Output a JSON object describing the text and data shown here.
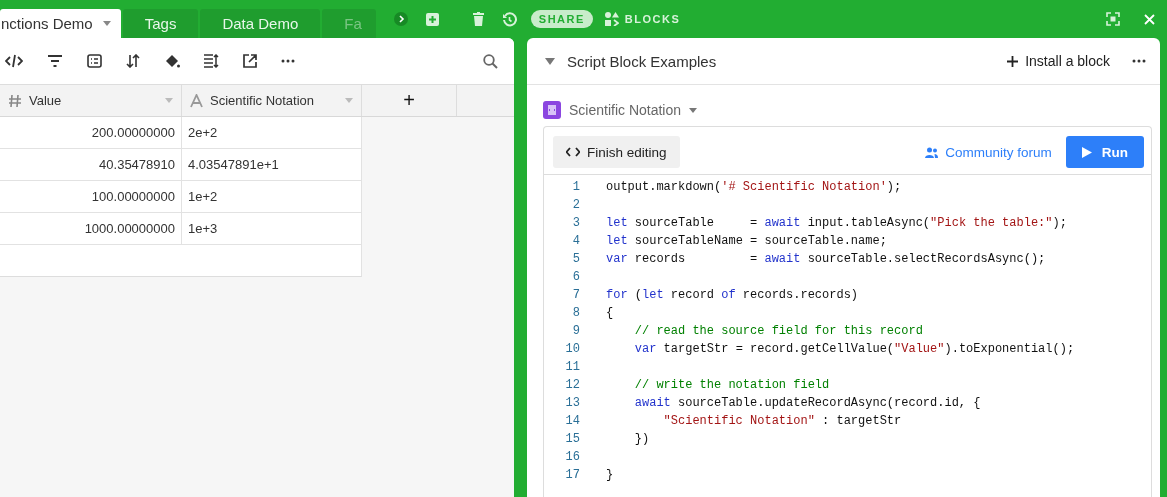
{
  "tabs": [
    {
      "label": "nctions Demo",
      "selected": true
    },
    {
      "label": "Tags",
      "selected": false
    },
    {
      "label": "Data Demo",
      "selected": false
    },
    {
      "label": "Fa",
      "selected": false
    }
  ],
  "top_bar": {
    "share": "SHARE",
    "blocks": "BLOCKS"
  },
  "table": {
    "columns": [
      {
        "label": "Value",
        "kind": "number"
      },
      {
        "label": "Scientific Notation",
        "kind": "text"
      }
    ],
    "add_column": "+",
    "rows": [
      {
        "value": "200.00000000",
        "notation": "2e+2"
      },
      {
        "value": "40.35478910",
        "notation": "4.03547891e+1"
      },
      {
        "value": "100.00000000",
        "notation": "1e+2"
      },
      {
        "value": "1000.00000000",
        "notation": "1e+3"
      }
    ]
  },
  "blocks_panel": {
    "title": "Script Block Examples",
    "install": "Install a block",
    "block_name": "Scientific Notation",
    "finish_editing": "Finish editing",
    "community": "Community forum",
    "run": "Run",
    "code": [
      {
        "number": "1",
        "tokens": [
          {
            "kind": "plain",
            "text": "output.markdown("
          },
          {
            "kind": "string",
            "text": "'# Scientific Notation'"
          },
          {
            "kind": "plain",
            "text": ");"
          }
        ]
      },
      {
        "number": "2"
      },
      {
        "number": "3",
        "tokens": [
          {
            "kind": "keyword",
            "text": "let"
          },
          {
            "kind": "plain",
            "text": " sourceTable     = "
          },
          {
            "kind": "keyword",
            "text": "await"
          },
          {
            "kind": "plain",
            "text": " input.tableAsync("
          },
          {
            "kind": "string",
            "text": "\"Pick the table:\""
          },
          {
            "kind": "plain",
            "text": ");"
          }
        ]
      },
      {
        "number": "4",
        "tokens": [
          {
            "kind": "keyword",
            "text": "let"
          },
          {
            "kind": "plain",
            "text": " sourceTableName = sourceTable.name;"
          }
        ]
      },
      {
        "number": "5",
        "tokens": [
          {
            "kind": "keyword",
            "text": "var"
          },
          {
            "kind": "plain",
            "text": " records         = "
          },
          {
            "kind": "keyword",
            "text": "await"
          },
          {
            "kind": "plain",
            "text": " sourceTable.selectRecordsAsync();"
          }
        ]
      },
      {
        "number": "6"
      },
      {
        "number": "7",
        "tokens": [
          {
            "kind": "keyword",
            "text": "for"
          },
          {
            "kind": "plain",
            "text": " ("
          },
          {
            "kind": "keyword",
            "text": "let"
          },
          {
            "kind": "plain",
            "text": " record "
          },
          {
            "kind": "keyword",
            "text": "of"
          },
          {
            "kind": "plain",
            "text": " records.records)"
          }
        ]
      },
      {
        "number": "8",
        "tokens": [
          {
            "kind": "plain",
            "text": "{"
          }
        ]
      },
      {
        "number": "9",
        "tokens": [
          {
            "kind": "comment",
            "text": "    // read the source field for this record"
          }
        ]
      },
      {
        "number": "10",
        "tokens": [
          {
            "kind": "keyword",
            "text": "    var"
          },
          {
            "kind": "plain",
            "text": " targetStr = record.getCellValue("
          },
          {
            "kind": "string",
            "text": "\"Value\""
          },
          {
            "kind": "plain",
            "text": ").toExponential();"
          }
        ]
      },
      {
        "number": "11"
      },
      {
        "number": "12",
        "tokens": [
          {
            "kind": "comment",
            "text": "    // write the notation field"
          }
        ]
      },
      {
        "number": "13",
        "tokens": [
          {
            "kind": "keyword",
            "text": "    await"
          },
          {
            "kind": "plain",
            "text": " sourceTable.updateRecordAsync(record.id, {"
          }
        ]
      },
      {
        "number": "14",
        "tokens": [
          {
            "kind": "string",
            "text": "        \"Scientific Notation\""
          },
          {
            "kind": "plain",
            "text": " : targetStr"
          }
        ]
      },
      {
        "number": "15",
        "tokens": [
          {
            "kind": "plain",
            "text": "    })"
          }
        ]
      },
      {
        "number": "16"
      },
      {
        "number": "17",
        "tokens": [
          {
            "kind": "plain",
            "text": "}"
          }
        ]
      }
    ]
  }
}
